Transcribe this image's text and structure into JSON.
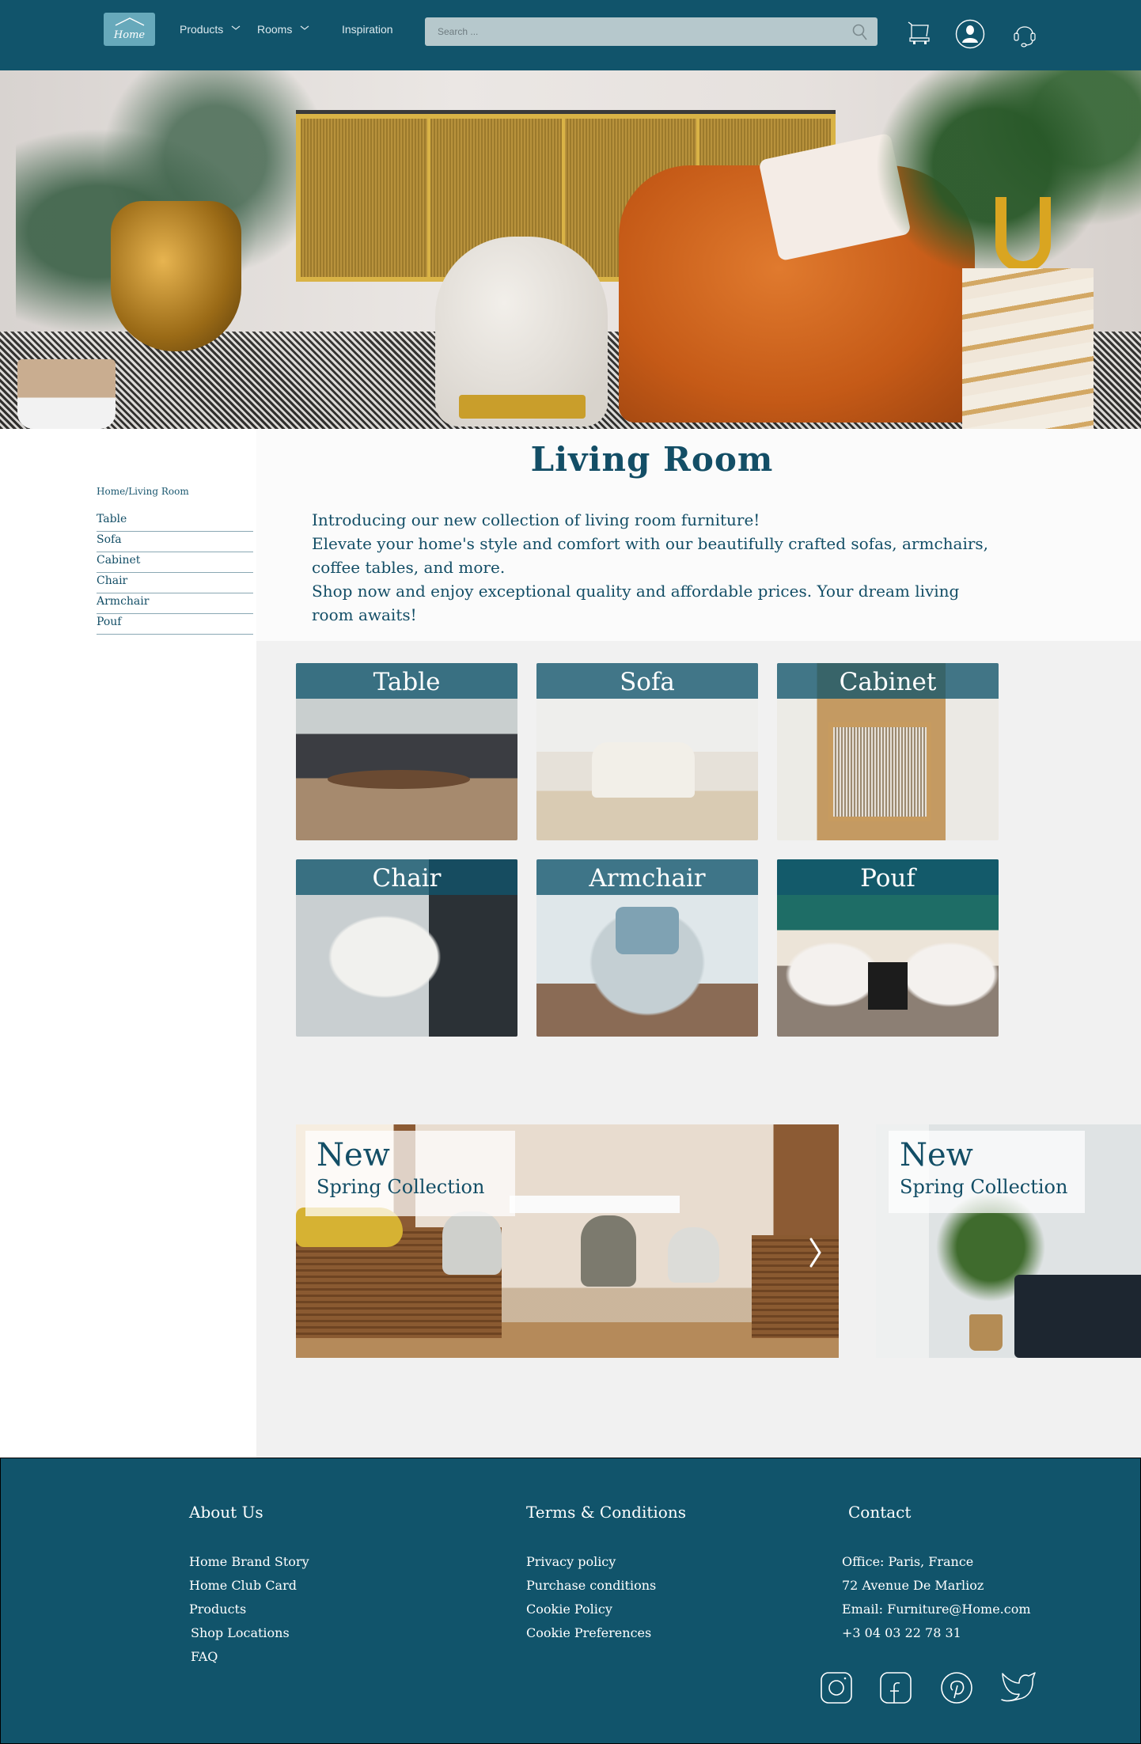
{
  "header": {
    "logo_label": "Home",
    "nav": [
      {
        "label": "Products",
        "has_dropdown": true
      },
      {
        "label": "Rooms",
        "has_dropdown": true
      },
      {
        "label": "Inspiration",
        "has_dropdown": false
      }
    ],
    "search": {
      "placeholder": "Search ...",
      "value": ""
    },
    "icons": [
      "cart-icon",
      "user-account-icon",
      "headset-support-icon"
    ]
  },
  "hero": {
    "image": "living-room-hero-orange-armchair"
  },
  "sidebar": {
    "breadcrumb": "Home/Living Room",
    "items": [
      {
        "label": "Table"
      },
      {
        "label": "Sofa"
      },
      {
        "label": "Cabinet"
      },
      {
        "label": "Chair"
      },
      {
        "label": "Armchair"
      },
      {
        "label": "Pouf"
      }
    ]
  },
  "main": {
    "title": "Living Room",
    "intro_lines": [
      "Introducing our new collection of living room furniture!",
      "Elevate your home's style and comfort with our beautifully crafted sofas, armchairs, coffee tables, and more.",
      "Shop now and enjoy exceptional quality and affordable prices. Your dream living room awaits!"
    ],
    "categories": [
      {
        "label": "Table",
        "image": "coffee-table-photo"
      },
      {
        "label": "Sofa",
        "image": "white-sofa-photo"
      },
      {
        "label": "Cabinet",
        "image": "rattan-cabinet-photo"
      },
      {
        "label": "Chair",
        "image": "white-shell-chair-photo"
      },
      {
        "label": "Armchair",
        "image": "grey-armchair-photo"
      },
      {
        "label": "Pouf",
        "image": "white-poufs-fireplace-photo"
      }
    ],
    "promos": [
      {
        "title": "New",
        "subtitle": "Spring Collection",
        "image": "dining-set-photo"
      },
      {
        "title": "New",
        "subtitle": "Spring Collection",
        "image": "tree-and-black-sofa-photo"
      }
    ]
  },
  "footer": {
    "columns": [
      {
        "heading": "About Us",
        "links": [
          "Home Brand Story",
          "Home Club Card",
          "Products",
          "Shop Locations",
          "FAQ"
        ]
      },
      {
        "heading": "Terms & Conditions",
        "links": [
          "Privacy policy",
          "Purchase conditions",
          "Cookie Policy",
          "Cookie Preferences"
        ]
      },
      {
        "heading": "Contact",
        "links": [
          "Office:  Paris, France",
          "72 Avenue De Marlioz",
          "Email: Furniture@Home.com",
          "+3 04 03 22 78 31"
        ]
      }
    ],
    "social": [
      "instagram-icon",
      "facebook-icon",
      "pinterest-icon",
      "twitter-icon"
    ]
  },
  "colors": {
    "brand": "#11546b",
    "logo_bg": "#67a9bb",
    "search_bg": "#b6c8cc",
    "content_bg": "#f1f1f1",
    "text": "#134e66"
  }
}
